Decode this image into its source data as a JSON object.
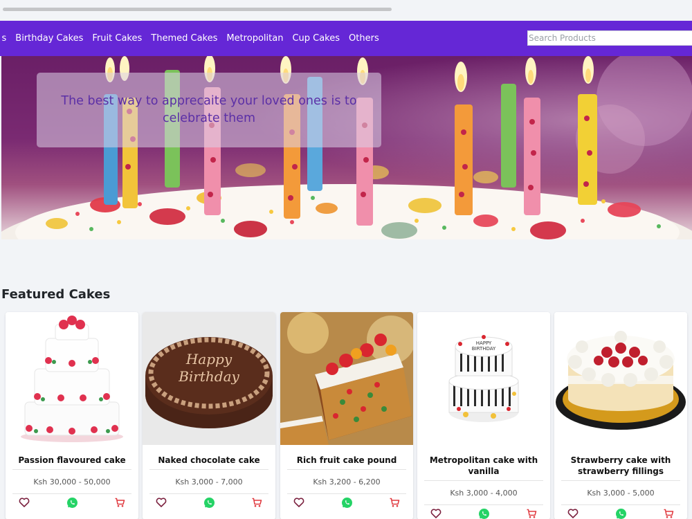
{
  "nav": {
    "items": [
      {
        "label": "s"
      },
      {
        "label": "Birthday Cakes"
      },
      {
        "label": "Fruit Cakes"
      },
      {
        "label": "Themed Cakes"
      },
      {
        "label": "Metropolitan"
      },
      {
        "label": "Cup Cakes"
      },
      {
        "label": "Others"
      }
    ],
    "search_placeholder": "Search Products"
  },
  "hero": {
    "caption": "The best way to apprecaite your loved ones is to celebrate them"
  },
  "featured": {
    "title": "Featured Cakes",
    "products": [
      {
        "name": "Passion flavoured cake",
        "price": "Ksh 30,000 - 50,000",
        "image_icon": "white-tiered-cake-image"
      },
      {
        "name": "Naked chocolate cake",
        "price": "Ksh 3,000 - 7,000",
        "image_icon": "chocolate-birthday-cake-image"
      },
      {
        "name": "Rich fruit cake pound",
        "price": "Ksh 3,200 - 6,200",
        "image_icon": "fruit-cake-image"
      },
      {
        "name": "Metropolitan cake with vanilla",
        "price": "Ksh 3,000 - 4,000",
        "image_icon": "metropolitan-cake-image"
      },
      {
        "name": "Strawberry cake with strawberry fillings",
        "price": "Ksh 3,000 - 5,000",
        "image_icon": "strawberry-cake-image"
      }
    ]
  },
  "colors": {
    "navbar": "#6527d6",
    "heart": "#7a1f3d",
    "whatsapp": "#25d366",
    "cart": "#e0383e",
    "caption_text": "#5b2fa6"
  }
}
